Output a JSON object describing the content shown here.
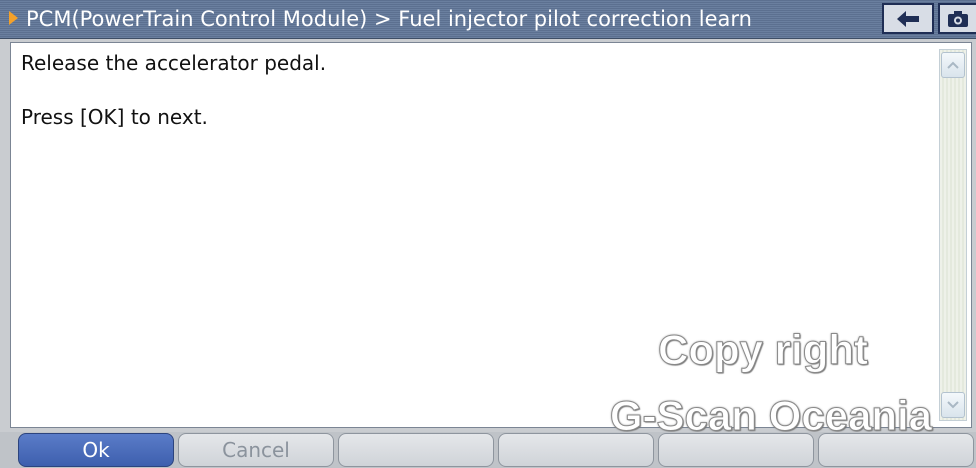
{
  "header": {
    "title": "PCM(PowerTrain Control Module) > Fuel injector pilot correction learn",
    "buttons": [
      {
        "name": "back",
        "icon": "back-arrow-icon"
      },
      {
        "name": "capture",
        "icon": "camera-icon"
      }
    ]
  },
  "message": {
    "line1": "Release the accelerator pedal.",
    "line2": "Press [OK] to next."
  },
  "watermark": {
    "line1": "Copy right",
    "line2": "G-Scan Oceania"
  },
  "footer": {
    "buttons": [
      {
        "label": "Ok",
        "active": true
      },
      {
        "label": "Cancel",
        "active": false
      },
      {
        "label": "",
        "active": false
      },
      {
        "label": "",
        "active": false
      },
      {
        "label": "",
        "active": false
      },
      {
        "label": "",
        "active": false
      }
    ]
  },
  "colors": {
    "title_bg": "#5f7393",
    "title_arrow": "#f4a12a",
    "ok_button": "#4a6bbd",
    "toolbar_border": "#1f2e55"
  }
}
